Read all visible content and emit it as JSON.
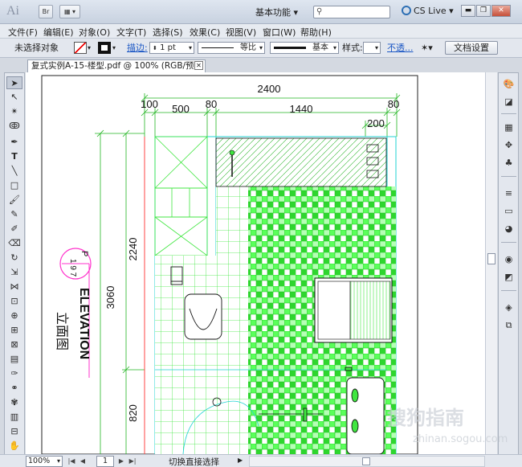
{
  "titlebar": {
    "app_logo": "Ai",
    "bridge_label": "Br",
    "workspace": "基本功能",
    "cslive": "CS Live",
    "minimize": "▬",
    "restore": "❐",
    "close": "✕"
  },
  "menu": [
    "文件(F)",
    "编辑(E)",
    "对象(O)",
    "文字(T)",
    "选择(S)",
    "效果(C)",
    "视图(V)",
    "窗口(W)",
    "帮助(H)"
  ],
  "control": {
    "selection": "未选择对象",
    "stroke_label": "描边:",
    "stroke_weight": "1 pt",
    "profile": "等比",
    "brush": "基本",
    "style_label": "样式:",
    "opacity_label": "不透...",
    "doc_settings": "文档设置"
  },
  "document": {
    "tab_title": "复式实例A-15-楼型.pdf @ 100% (RGB/预览)",
    "close": "✕"
  },
  "drawing": {
    "dims_top": [
      "2400",
      "100",
      "500",
      "80",
      "1440",
      "80",
      "200"
    ],
    "dims_left": [
      "3060",
      "2240",
      "820"
    ],
    "elevation": "ELEVATION",
    "elevation_cn": "立面图",
    "marker_top": "P",
    "marker_bottom": "1 9 7"
  },
  "status": {
    "zoom": "100%",
    "page": "1",
    "text": "切换直接选择"
  },
  "watermark": {
    "text": "搜狗指南",
    "url": "zhinan.sogou.com"
  },
  "colors": {
    "accent_green": "#3fe63f",
    "cyan": "#22d3d3",
    "dim_green": "#23b523",
    "marker_magenta": "#ff33cc"
  }
}
